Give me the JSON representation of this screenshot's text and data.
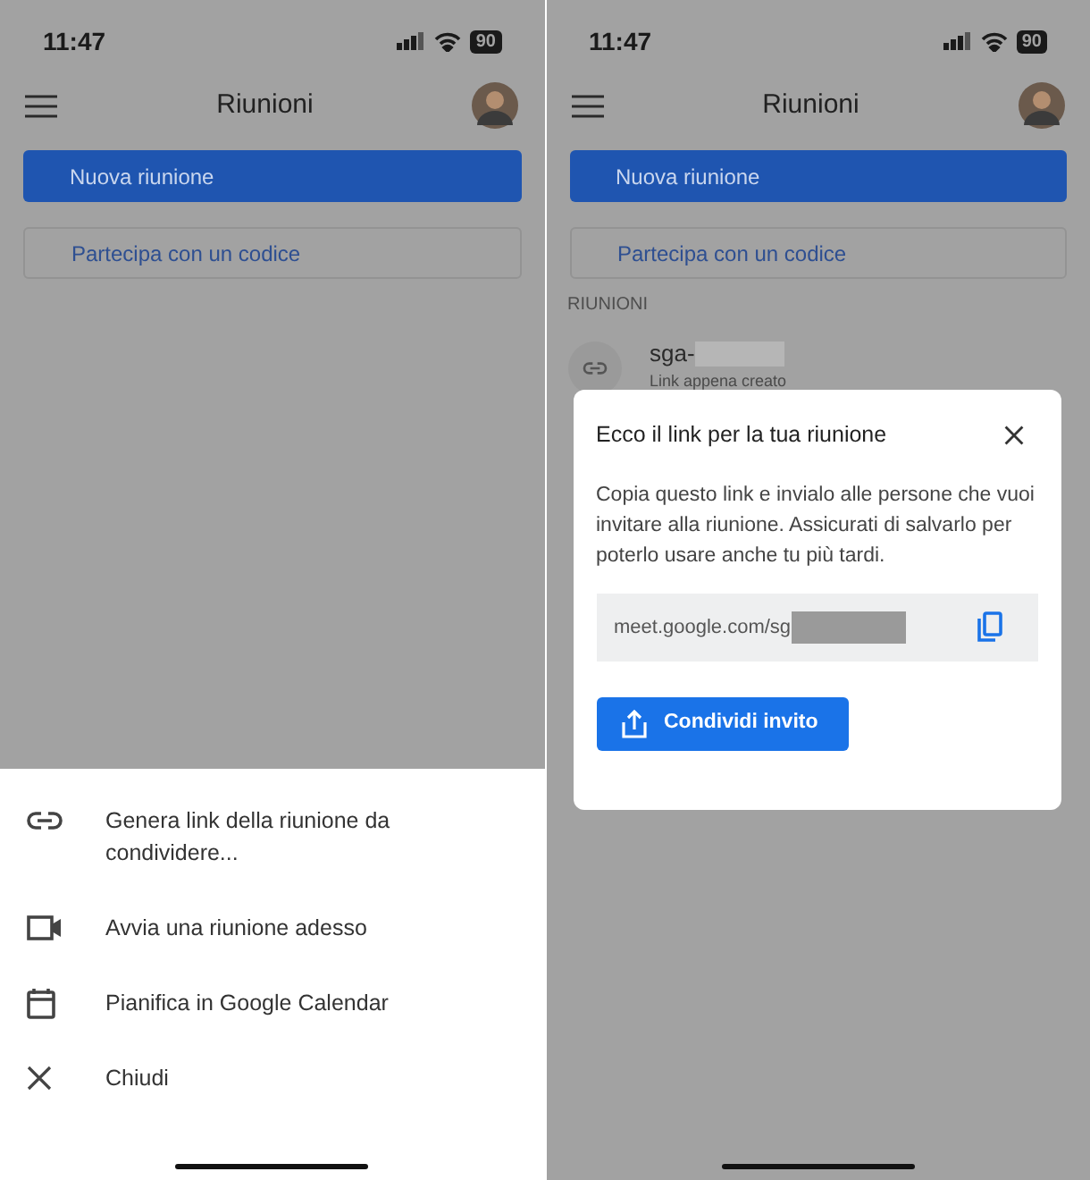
{
  "screens": [
    {
      "status_bar": {
        "time": "11:47",
        "battery": "90"
      },
      "header": {
        "title": "Riunioni"
      },
      "new_meeting_button": "Nuova riunione",
      "join_button": "Partecipa con un codice",
      "sheet": {
        "items": [
          {
            "kind": "link",
            "label": "Genera link della riunione da condividere..."
          },
          {
            "kind": "video",
            "label": "Avvia una riunione adesso"
          },
          {
            "kind": "calendar",
            "label": "Pianifica in Google Calendar"
          },
          {
            "kind": "close",
            "label": "Chiudi"
          }
        ]
      }
    },
    {
      "status_bar": {
        "time": "11:47",
        "battery": "90"
      },
      "header": {
        "title": "Riunioni"
      },
      "new_meeting_button": "Nuova riunione",
      "join_button": "Partecipa con un codice",
      "section_label": "RIUNIONI",
      "meeting": {
        "name": "sga-",
        "subtitle": "Link appena creato"
      },
      "dialog": {
        "title": "Ecco il link per la tua riunione",
        "body": "Copia questo link e invialo alle persone che vuoi invitare alla riunione. Assicurati di salvarlo per poterlo usare anche tu più tardi.",
        "link": "meet.google.com/sg",
        "share_button": "Condividi invito"
      }
    }
  ]
}
